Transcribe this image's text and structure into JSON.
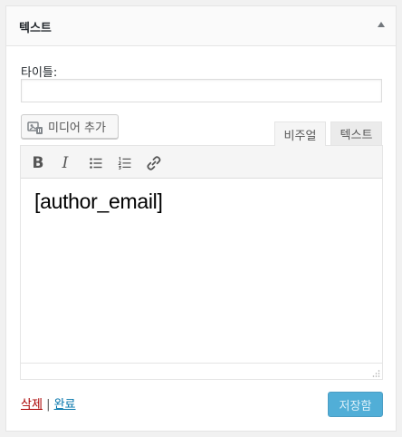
{
  "widget": {
    "title": "텍스트"
  },
  "form": {
    "title_label": "타이틀:",
    "title_value": "",
    "media_button_label": "미디어 추가"
  },
  "editor": {
    "tabs": [
      {
        "label": "비주얼",
        "active": true
      },
      {
        "label": "텍스트",
        "active": false
      }
    ],
    "toolbar": {
      "bold_glyph": "B",
      "italic_glyph": "I",
      "icons": [
        "bold-icon",
        "italic-icon",
        "bulleted-list-icon",
        "numbered-list-icon",
        "link-icon"
      ]
    },
    "content": "[author_email]"
  },
  "actions": {
    "delete_label": "삭제",
    "separator": "|",
    "done_label": "완료",
    "save_label": "저장함"
  },
  "colors": {
    "primary_button": "#33a1d1",
    "delete_link": "#aa0000",
    "done_link": "#0073aa"
  }
}
